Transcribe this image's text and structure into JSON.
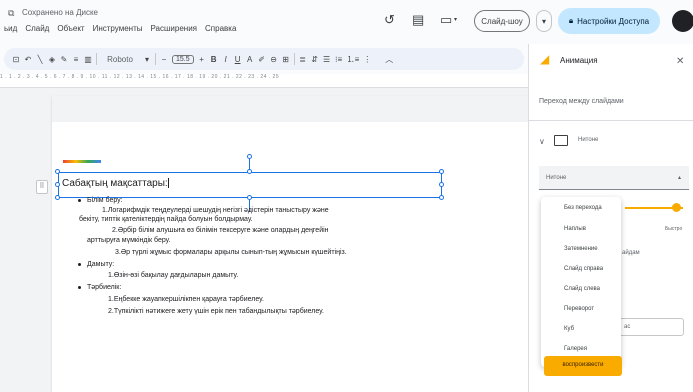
{
  "header": {
    "saved_status": "Сохранено на Диске",
    "menus": [
      "ьид",
      "Слайд",
      "Объект",
      "Инструменты",
      "Расширения",
      "Справка"
    ],
    "slideshow_label": "Слайд-шоу",
    "share_label": "Настройки Доступа"
  },
  "toolbar": {
    "font": "Roboto",
    "font_size": "15.5",
    "ruler_text": "1  .  1  .  2  .  3  .  4  .  5  .  6  .  7  .  8  .  9  .  10  .  11  .  12  .  13  .  14  .  15  .  16  .  17  .  18  .  19  .  20  .  21  .  22  .  23  .  24  .  25"
  },
  "slide": {
    "title": "Сабақтың мақсаттары:",
    "lines": [
      {
        "text": "Білім беру:",
        "kind": "bullet"
      },
      {
        "text": "1.Логарифмдік теңдеулерді шешудің негізгі әдістерін таныстыру және",
        "kind": "sub"
      },
      {
        "text": "бекіту, типтік қателіктердің пайда болуын болдырмау.",
        "kind": "cont"
      },
      {
        "text": "2.Әрбір білім алушыға өз білімін тексеруге және олардың деңгейін",
        "kind": "sub"
      },
      {
        "text": "арттыруға мүмкіндік беру.",
        "kind": "cont"
      },
      {
        "text": "3.Әр түрлі жұмыс формалары арқылы сынып-тың жұмысын күшейтіңіз.",
        "kind": "sub"
      },
      {
        "text": "Дамыту:",
        "kind": "bullet"
      },
      {
        "text": "1.Өзін-өзі бақылау дағдыларын дамыту.",
        "kind": "sub"
      },
      {
        "text": "Тәрбиелік:",
        "kind": "bullet"
      },
      {
        "text": "1.Еңбекке жауапкершілікпен қарауға тәрбиелеу.",
        "kind": "sub"
      },
      {
        "text": "2.Түпкілікті нәтижеге жету үшін ерік пен табандылықты тәрбиелеу.",
        "kind": "sub"
      }
    ]
  },
  "panel": {
    "title": "Анимация",
    "transition_label": "Переход между слайдами",
    "thumb_label": "Нитоне",
    "type_value": "Нитоне",
    "speed_fast": "Быстро",
    "frag1": "айдам",
    "frag2": "ас",
    "menu_items": [
      "Без перехода",
      "Наплыв",
      "Затемнение",
      "Слайд справа",
      "Слайд слева",
      "Переворот",
      "Куб",
      "Галерея"
    ],
    "apply_label": "воспроизвести"
  }
}
